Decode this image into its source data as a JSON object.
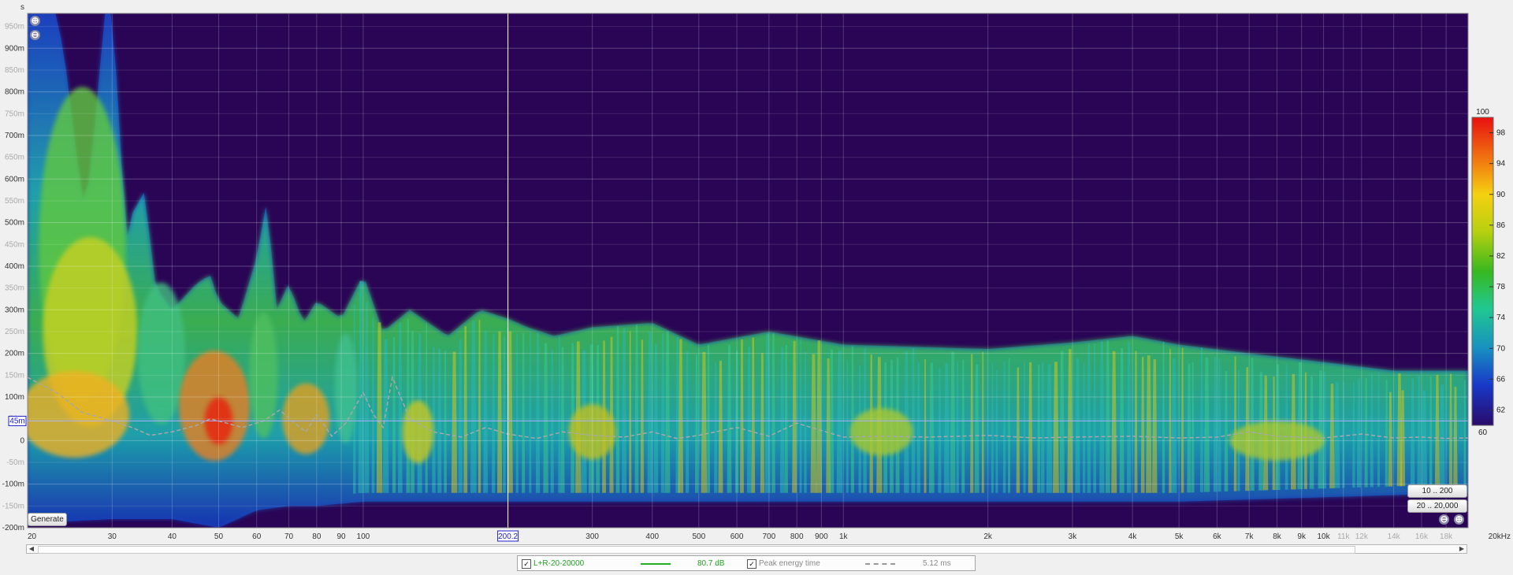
{
  "chart_data": {
    "type": "heatmap",
    "title": "",
    "xlabel": "",
    "ylabel": "s",
    "x_scale": "log",
    "xlim": [
      20,
      20000
    ],
    "ylim": [
      -0.2,
      0.98
    ],
    "x_ticks": [
      {
        "label": "20",
        "value": 20
      },
      {
        "label": "30",
        "value": 30
      },
      {
        "label": "40",
        "value": 40
      },
      {
        "label": "50",
        "value": 50
      },
      {
        "label": "60",
        "value": 60
      },
      {
        "label": "70",
        "value": 70
      },
      {
        "label": "80",
        "value": 80
      },
      {
        "label": "90",
        "value": 90
      },
      {
        "label": "100",
        "value": 100
      },
      {
        "label": "300",
        "value": 300
      },
      {
        "label": "400",
        "value": 400
      },
      {
        "label": "500",
        "value": 500
      },
      {
        "label": "600",
        "value": 600
      },
      {
        "label": "700",
        "value": 700
      },
      {
        "label": "800",
        "value": 800
      },
      {
        "label": "900",
        "value": 900
      },
      {
        "label": "1k",
        "value": 1000
      },
      {
        "label": "2k",
        "value": 2000
      },
      {
        "label": "3k",
        "value": 3000
      },
      {
        "label": "4k",
        "value": 4000
      },
      {
        "label": "5k",
        "value": 5000
      },
      {
        "label": "6k",
        "value": 6000
      },
      {
        "label": "7k",
        "value": 7000
      },
      {
        "label": "8k",
        "value": 8000
      },
      {
        "label": "9k",
        "value": 9000
      },
      {
        "label": "10k",
        "value": 10000
      },
      {
        "label": "11k",
        "value": 11000,
        "dim": true
      },
      {
        "label": "12k",
        "value": 12000,
        "dim": true
      },
      {
        "label": "14k",
        "value": 14000,
        "dim": true
      },
      {
        "label": "16k",
        "value": 16000,
        "dim": true
      },
      {
        "label": "18k",
        "value": 18000,
        "dim": true
      },
      {
        "label": "20kHz",
        "value": 20000
      }
    ],
    "y_ticks": [
      {
        "label": "950m",
        "value": 0.95,
        "dim": true
      },
      {
        "label": "900m",
        "value": 0.9
      },
      {
        "label": "850m",
        "value": 0.85,
        "dim": true
      },
      {
        "label": "800m",
        "value": 0.8
      },
      {
        "label": "750m",
        "value": 0.75,
        "dim": true
      },
      {
        "label": "700m",
        "value": 0.7
      },
      {
        "label": "650m",
        "value": 0.65,
        "dim": true
      },
      {
        "label": "600m",
        "value": 0.6
      },
      {
        "label": "550m",
        "value": 0.55,
        "dim": true
      },
      {
        "label": "500m",
        "value": 0.5
      },
      {
        "label": "450m",
        "value": 0.45,
        "dim": true
      },
      {
        "label": "400m",
        "value": 0.4
      },
      {
        "label": "350m",
        "value": 0.35,
        "dim": true
      },
      {
        "label": "300m",
        "value": 0.3
      },
      {
        "label": "250m",
        "value": 0.25,
        "dim": true
      },
      {
        "label": "200m",
        "value": 0.2
      },
      {
        "label": "150m",
        "value": 0.15,
        "dim": true
      },
      {
        "label": "100m",
        "value": 0.1
      },
      {
        "label": "50m",
        "value": 0.05,
        "dim": true
      },
      {
        "label": "0",
        "value": 0.0
      },
      {
        "label": "-50m",
        "value": -0.05,
        "dim": true
      },
      {
        "label": "-100m",
        "value": -0.1
      },
      {
        "label": "-150m",
        "value": -0.15,
        "dim": true
      },
      {
        "label": "-200m",
        "value": -0.2
      }
    ],
    "cursor": {
      "x_value": 200.2,
      "x_label": "200.2",
      "y_value": 0.045,
      "y_label": "45m"
    },
    "colorbar": {
      "min": 60,
      "max": 100,
      "max_label": "100",
      "min_label": "60",
      "ticks": [
        98,
        94,
        90,
        86,
        82,
        78,
        74,
        70,
        66,
        62
      ]
    },
    "series": [
      {
        "name": "L+R-20-20000",
        "value_label": "80.7 dB",
        "color": "#22b022"
      },
      {
        "name": "Peak energy time",
        "value_label": "5.12 ms",
        "color": "#999999"
      }
    ],
    "peak_energy_time": [
      [
        20,
        0.145
      ],
      [
        23,
        0.11
      ],
      [
        26,
        0.065
      ],
      [
        30,
        0.045
      ],
      [
        33,
        0.03
      ],
      [
        36,
        0.012
      ],
      [
        40,
        0.02
      ],
      [
        45,
        0.035
      ],
      [
        48,
        0.05
      ],
      [
        52,
        0.04
      ],
      [
        56,
        0.03
      ],
      [
        62,
        0.045
      ],
      [
        67,
        0.07
      ],
      [
        72,
        0.04
      ],
      [
        76,
        0.02
      ],
      [
        80,
        0.06
      ],
      [
        86,
        0.01
      ],
      [
        92,
        0.04
      ],
      [
        100,
        0.11
      ],
      [
        105,
        0.06
      ],
      [
        110,
        0.03
      ],
      [
        115,
        0.145
      ],
      [
        125,
        0.05
      ],
      [
        140,
        0.02
      ],
      [
        160,
        0.008
      ],
      [
        180,
        0.03
      ],
      [
        200,
        0.015
      ],
      [
        230,
        0.005
      ],
      [
        260,
        0.02
      ],
      [
        300,
        0.012
      ],
      [
        350,
        0.008
      ],
      [
        400,
        0.02
      ],
      [
        450,
        0.005
      ],
      [
        500,
        0.012
      ],
      [
        600,
        0.03
      ],
      [
        700,
        0.01
      ],
      [
        800,
        0.04
      ],
      [
        1000,
        0.008
      ],
      [
        1200,
        0.01
      ],
      [
        1500,
        0.008
      ],
      [
        2000,
        0.012
      ],
      [
        2500,
        0.006
      ],
      [
        3000,
        0.008
      ],
      [
        4000,
        0.01
      ],
      [
        5000,
        0.006
      ],
      [
        6000,
        0.008
      ],
      [
        7000,
        0.02
      ],
      [
        8000,
        0.01
      ],
      [
        10000,
        0.006
      ],
      [
        12000,
        0.015
      ],
      [
        14000,
        0.006
      ],
      [
        16000,
        0.008
      ],
      [
        18000,
        0.005
      ],
      [
        20000,
        0.006
      ]
    ],
    "upper_envelope": [
      [
        20,
        0.98
      ],
      [
        22,
        0.98
      ],
      [
        23,
        0.98
      ],
      [
        24,
        0.86
      ],
      [
        25,
        0.7
      ],
      [
        26,
        0.55
      ],
      [
        27,
        0.6
      ],
      [
        28,
        0.8
      ],
      [
        29,
        0.98
      ],
      [
        30,
        0.98
      ],
      [
        31,
        0.75
      ],
      [
        32,
        0.45
      ],
      [
        33,
        0.52
      ],
      [
        35,
        0.57
      ],
      [
        37,
        0.35
      ],
      [
        40,
        0.3
      ],
      [
        45,
        0.36
      ],
      [
        48,
        0.38
      ],
      [
        50,
        0.32
      ],
      [
        55,
        0.28
      ],
      [
        60,
        0.42
      ],
      [
        63,
        0.55
      ],
      [
        66,
        0.3
      ],
      [
        70,
        0.36
      ],
      [
        75,
        0.27
      ],
      [
        80,
        0.32
      ],
      [
        90,
        0.28
      ],
      [
        100,
        0.38
      ],
      [
        110,
        0.25
      ],
      [
        125,
        0.3
      ],
      [
        150,
        0.24
      ],
      [
        175,
        0.3
      ],
      [
        200,
        0.28
      ],
      [
        220,
        0.26
      ],
      [
        250,
        0.24
      ],
      [
        300,
        0.26
      ],
      [
        400,
        0.27
      ],
      [
        500,
        0.22
      ],
      [
        700,
        0.25
      ],
      [
        1000,
        0.22
      ],
      [
        2000,
        0.21
      ],
      [
        3000,
        0.225
      ],
      [
        4000,
        0.24
      ],
      [
        5000,
        0.22
      ],
      [
        7000,
        0.2
      ],
      [
        10000,
        0.18
      ],
      [
        14000,
        0.16
      ],
      [
        20000,
        0.16
      ]
    ],
    "lower_envelope": [
      [
        20,
        -0.19
      ],
      [
        30,
        -0.18
      ],
      [
        40,
        -0.18
      ],
      [
        50,
        -0.2
      ],
      [
        60,
        -0.16
      ],
      [
        70,
        -0.15
      ],
      [
        80,
        -0.15
      ],
      [
        100,
        -0.14
      ],
      [
        200,
        -0.14
      ],
      [
        500,
        -0.14
      ],
      [
        1000,
        -0.14
      ],
      [
        5000,
        -0.14
      ],
      [
        10000,
        -0.13
      ],
      [
        20000,
        -0.12
      ]
    ]
  },
  "ui": {
    "y_unit": "s",
    "generate_label": "Generate",
    "range_btn_1": "10 .. 200",
    "range_btn_2": "20 .. 20,000",
    "zoom_in_glyph": "⊕",
    "zoom_out_glyph": "⊖",
    "legend": {
      "series_label": "L+R-20-20000",
      "series_value": "80.7 dB",
      "peak_label": "Peak energy time",
      "peak_value": "5.12 ms",
      "check_glyph": "✓"
    },
    "scroll_left_glyph": "◀",
    "scroll_right_glyph": "▶"
  }
}
